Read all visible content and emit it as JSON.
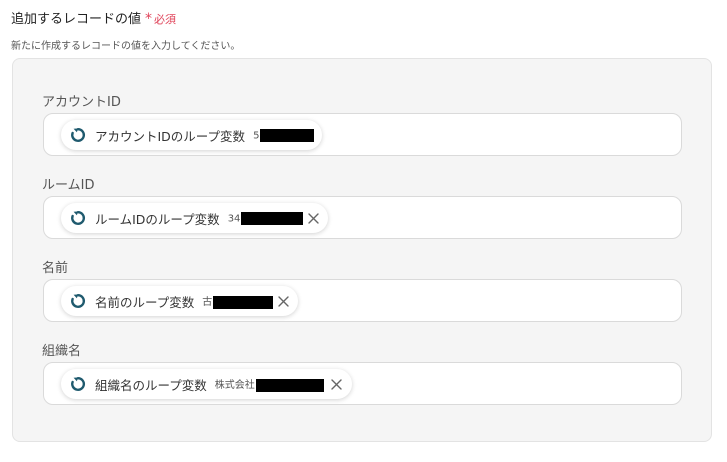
{
  "section": {
    "title": "追加するレコードの値",
    "required_mark": "*",
    "required_label": "必須",
    "description": "新たに作成するレコードの値を入力してください。"
  },
  "fields": [
    {
      "label": "アカウントID",
      "chip_label": "アカウントIDのループ変数",
      "chip_value_prefix": "5"
    },
    {
      "label": "ルームID",
      "chip_label": "ルームIDのループ変数",
      "chip_value_prefix": "34"
    },
    {
      "label": "名前",
      "chip_label": "名前のループ変数",
      "chip_value_prefix": "古"
    },
    {
      "label": "組織名",
      "chip_label": "組織名のループ変数",
      "chip_value_prefix": "株式会社"
    }
  ],
  "icons": {
    "chip_icon": "loop-refresh-icon",
    "remove_icon": "close-icon"
  },
  "colors": {
    "required": "#e0445a",
    "loop_icon": "#1f5a6e",
    "panel_bg": "#f5f5f5"
  }
}
